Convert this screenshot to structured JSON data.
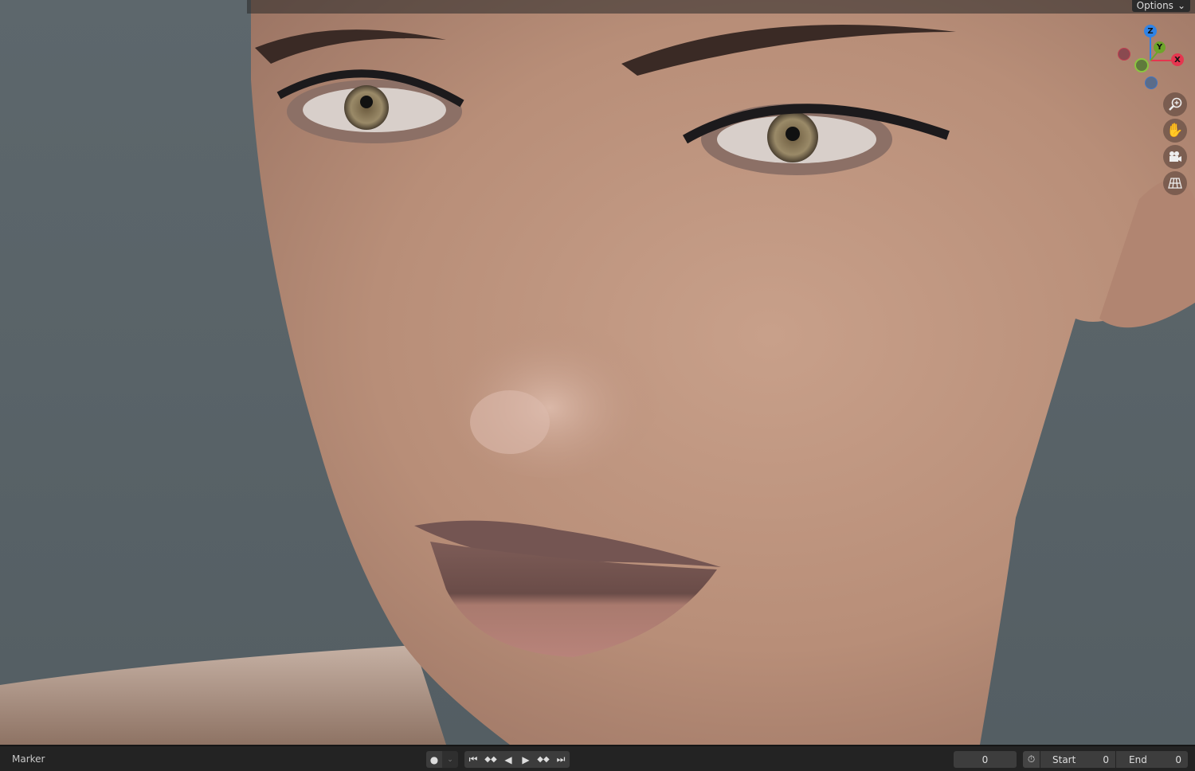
{
  "header": {
    "options_label": "Options"
  },
  "gizmo": {
    "axes": [
      {
        "label": "Z",
        "color": "#2f83e6"
      },
      {
        "label": "Y",
        "color": "#6ea52a"
      },
      {
        "label": "X",
        "color": "#e5364f"
      }
    ]
  },
  "nav_icons": [
    "zoom-icon",
    "hand-pan-icon",
    "camera-icon",
    "grid-perspective-icon"
  ],
  "timeline": {
    "marker_label": "Marker",
    "current_frame": "0",
    "start_label": "Start",
    "start_value": "0",
    "end_label": "End",
    "end_value": "0"
  }
}
